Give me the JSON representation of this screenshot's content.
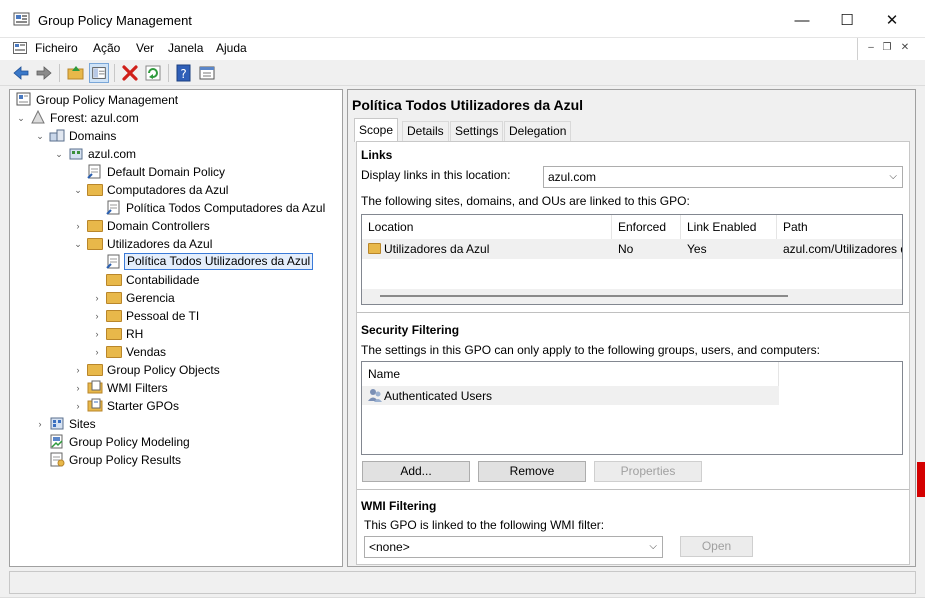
{
  "window": {
    "title": "Group Policy Management",
    "minimize": "—",
    "maximize": "☐",
    "close": "✕",
    "mdi_min": "–",
    "mdi_restore": "❐",
    "mdi_close": "✕"
  },
  "menu": {
    "items": [
      "Ficheiro",
      "Ação",
      "Ver",
      "Janela",
      "Ajuda"
    ]
  },
  "toolbar": {
    "buttons": [
      "back-arrow-icon",
      "forward-arrow-icon",
      "up-folder-icon",
      "show-hide-tree-icon",
      "delete-icon",
      "refresh-icon",
      "help-icon",
      "properties-icon"
    ]
  },
  "tree": {
    "root": "Group Policy Management",
    "forest": "Forest: azul.com",
    "domains": "Domains",
    "domain": "azul.com",
    "default_policy": "Default Domain Policy",
    "computadores": "Computadores da Azul",
    "politica_computadores": "Política Todos Computadores da Azul",
    "domain_controllers": "Domain Controllers",
    "utilizadores": "Utilizadores da Azul",
    "politica_utilizadores": "Política Todos Utilizadores da Azul",
    "contabilidade": "Contabilidade",
    "gerencia": "Gerencia",
    "pessoal": "Pessoal de TI",
    "rh": "RH",
    "vendas": "Vendas",
    "gpo_objects": "Group Policy Objects",
    "wmi_filters": "WMI Filters",
    "starter_gpos": "Starter GPOs",
    "sites": "Sites",
    "modeling": "Group Policy Modeling",
    "results": "Group Policy Results"
  },
  "details": {
    "title": "Política Todos Utilizadores da Azul",
    "tabs": [
      "Scope",
      "Details",
      "Settings",
      "Delegation"
    ],
    "links": {
      "heading": "Links",
      "display_label": "Display links in this location:",
      "location_value": "azul.com",
      "linked_text": "The following sites, domains, and OUs are linked to this GPO:",
      "columns": [
        "Location",
        "Enforced",
        "Link Enabled",
        "Path"
      ],
      "row": {
        "location": "Utilizadores da Azul",
        "enforced": "No",
        "link_enabled": "Yes",
        "path": "azul.com/Utilizadores da"
      }
    },
    "security": {
      "heading": "Security Filtering",
      "text": "The settings in this GPO can only apply to the following groups, users, and computers:",
      "column": "Name",
      "row": "Authenticated Users",
      "add": "Add...",
      "remove": "Remove",
      "properties": "Properties"
    },
    "wmi": {
      "heading": "WMI Filtering",
      "text": "This GPO is linked to the following WMI filter:",
      "value": "<none>",
      "open": "Open"
    }
  },
  "colors": {
    "accent": "#3a7ad8",
    "folder": "#e8b84a",
    "red_edge": "#d40000"
  }
}
